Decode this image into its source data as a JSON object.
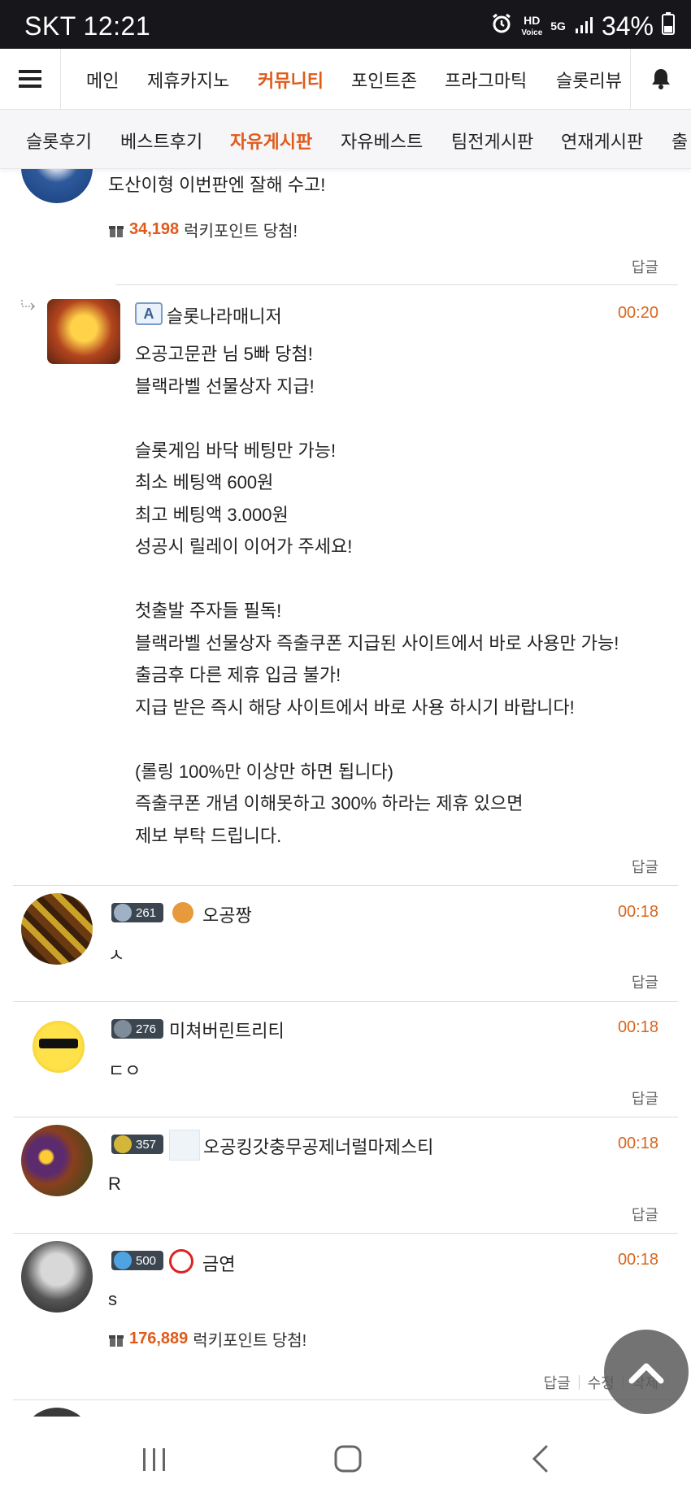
{
  "status_bar": {
    "carrier_time": "SKT 12:21",
    "battery": "34%",
    "hd_label": "HD",
    "voice_label": "Voice",
    "net_label": "5G"
  },
  "top_nav": {
    "tabs": [
      "메인",
      "제휴카지노",
      "커뮤니티",
      "포인트존",
      "프라그마틱",
      "슬롯리뷰"
    ],
    "active_tab": "커뮤니티"
  },
  "sub_nav": {
    "tabs": [
      "슬롯후기",
      "베스트후기",
      "자유게시판",
      "자유베스트",
      "팀전게시판",
      "연재게시판",
      "출"
    ],
    "active_tab": "자유게시판"
  },
  "comments": [
    {
      "text": "도산이형 이번판엔 잘해 수고!",
      "lucky_points": "34,198",
      "lucky_text": "럭키포인트 당첨!",
      "reply_label": "답글"
    },
    {
      "badge_letter": "A",
      "author": "슬롯나라매니저",
      "time": "00:20",
      "lines": [
        "오공고문관 님 5빠 당첨!",
        "블랙라벨 선물상자 지급!",
        "",
        "슬롯게임 바닥 베팅만 가능!",
        "최소 베팅액 600원",
        "최고 베팅액 3.000원",
        "성공시 릴레이 이어가 주세요!",
        "",
        "첫출발 주자들 필독!",
        "블랙라벨 선물상자 즉출쿠폰 지급된 사이트에서 바로 사용만 가능!",
        "출금후 다른 제휴 입금 불가!",
        "지급 받은 즉시 해당 사이트에서 바로 사용 하시기 바랍니다!",
        "",
        "(롤링 100%만 이상만 하면 됩니다)",
        "즉출쿠폰 개념 이해못하고 300% 하라는 제휴 있으면",
        "제보 부탁 드립니다."
      ],
      "reply_label": "답글"
    },
    {
      "level": "261",
      "author": "오공짱",
      "time": "00:18",
      "text": "ㅅ",
      "reply_label": "답글"
    },
    {
      "level": "276",
      "author": "미쳐버린트리티",
      "time": "00:18",
      "text": "ㄷㅇ",
      "reply_label": "답글"
    },
    {
      "level": "357",
      "author": "오공킹갓충무공제너럴마제스티",
      "time": "00:18",
      "text": "R",
      "reply_label": "답글"
    },
    {
      "level": "500",
      "author": "금연",
      "time": "00:18",
      "text": "s",
      "lucky_points": "176,889",
      "lucky_text": "럭키포인트 당첨!",
      "actions": [
        "답글",
        "수정",
        "삭제"
      ]
    }
  ],
  "colors": {
    "accent": "#e05a1a",
    "time": "#d9651c",
    "status_bar": "#16161b"
  },
  "icons": [
    "menu-icon",
    "bell-icon",
    "gift-icon",
    "reply-arrow-icon",
    "scroll-top-icon",
    "recents-icon",
    "home-icon",
    "back-icon"
  ]
}
